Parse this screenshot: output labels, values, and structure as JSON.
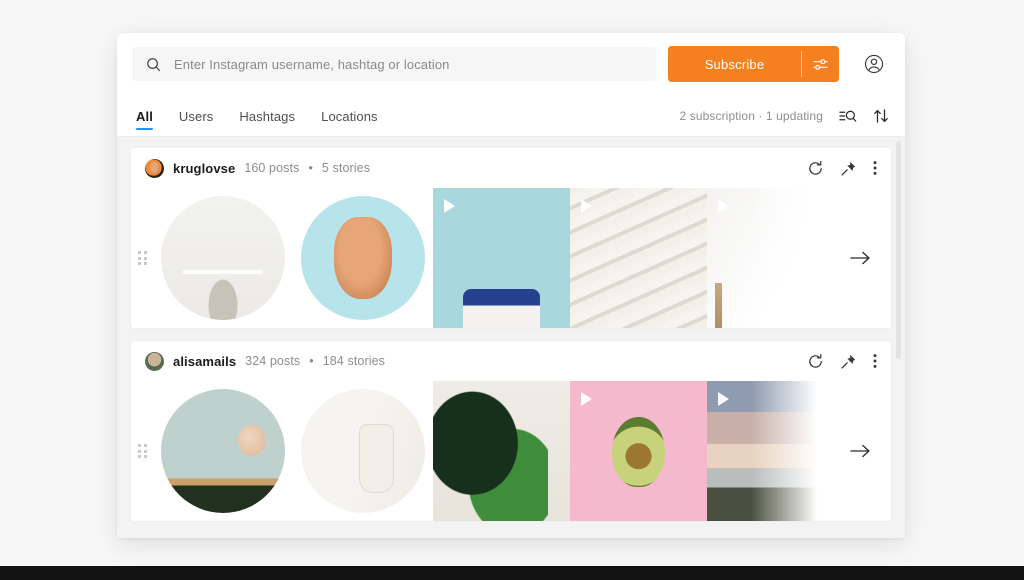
{
  "search": {
    "placeholder": "Enter Instagram username, hashtag or location",
    "value": "",
    "icon": "search-icon"
  },
  "toolbar": {
    "subscribe_label": "Subscribe",
    "subscribe_options_icon": "sliders-icon",
    "account_icon": "account-circle-icon",
    "accent_color": "#f5801f"
  },
  "tabs": {
    "active_color": "#2196f3",
    "items": [
      {
        "label": "All",
        "active": true
      },
      {
        "label": "Users",
        "active": false
      },
      {
        "label": "Hashtags",
        "active": false
      },
      {
        "label": "Locations",
        "active": false
      }
    ]
  },
  "status": {
    "text": "2 subscription · 1 updating",
    "filter_icon": "filter-search-icon",
    "sort_icon": "sort-arrows-icon"
  },
  "cards": [
    {
      "username": "kruglovse",
      "posts": "160 posts",
      "separator": "•",
      "stories": "5 stories",
      "drag_handle_icon": "drag-grip-icon",
      "actions": [
        {
          "name": "refresh-icon",
          "label": "Refresh"
        },
        {
          "name": "pin-icon",
          "label": "Pin"
        },
        {
          "name": "more-vertical-icon",
          "label": "More"
        }
      ],
      "next_icon": "arrow-right-icon",
      "thumbnails": [
        {
          "shape": "circle",
          "art": "art-desk",
          "video": false
        },
        {
          "shape": "circle",
          "art": "art-hat",
          "video": false
        },
        {
          "shape": "square",
          "art": "art-shop",
          "video": true
        },
        {
          "shape": "square",
          "art": "art-sand",
          "video": true
        },
        {
          "shape": "square",
          "art": "art-white",
          "video": true
        }
      ]
    },
    {
      "username": "alisamails",
      "posts": "324 posts",
      "separator": "•",
      "stories": "184 stories",
      "drag_handle_icon": "drag-grip-icon",
      "actions": [
        {
          "name": "refresh-icon",
          "label": "Refresh"
        },
        {
          "name": "pin-icon",
          "label": "Pin"
        },
        {
          "name": "more-vertical-icon",
          "label": "More"
        }
      ],
      "next_icon": "arrow-right-icon",
      "thumbnails": [
        {
          "shape": "circle",
          "art": "art-lamp",
          "video": false
        },
        {
          "shape": "circle",
          "art": "art-kitchen",
          "video": false
        },
        {
          "shape": "square",
          "art": "art-monstera",
          "video": false
        },
        {
          "shape": "square",
          "art": "art-avocado",
          "video": true
        },
        {
          "shape": "square",
          "art": "art-sunset",
          "video": true
        }
      ]
    }
  ]
}
